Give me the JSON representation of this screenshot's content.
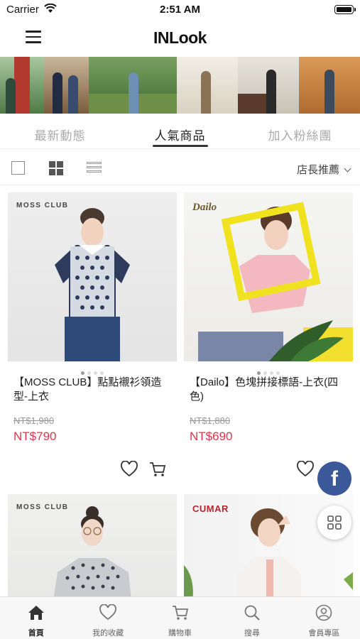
{
  "status_bar": {
    "carrier": "Carrier",
    "time": "2:51 AM"
  },
  "header": {
    "logo": "INLook"
  },
  "tabs": [
    {
      "label": "最新動態",
      "active": false
    },
    {
      "label": "人氣商品",
      "active": true
    },
    {
      "label": "加入粉絲團",
      "active": false
    }
  ],
  "view_bar": {
    "sort_label": "店長推薦"
  },
  "products": [
    {
      "brand": "MOSS CLUB",
      "name": "【MOSS CLUB】點點襯衫領造型-上衣",
      "old_price": "NT$1,980",
      "price": "NT$790"
    },
    {
      "brand": "Dailo",
      "name": "【Dailo】色塊拼接標語-上衣(四色)",
      "old_price": "NT$1,880",
      "price": "NT$690"
    },
    {
      "brand": "MOSS CLUB"
    },
    {
      "brand": "CUMAR"
    }
  ],
  "floating": {
    "facebook": "f"
  },
  "bottom_nav": [
    {
      "label": "首頁",
      "icon": "home-icon",
      "active": true
    },
    {
      "label": "我的收藏",
      "icon": "heart-icon",
      "active": false
    },
    {
      "label": "購物車",
      "icon": "cart-icon",
      "active": false
    },
    {
      "label": "搜尋",
      "icon": "search-icon",
      "active": false
    },
    {
      "label": "會員專區",
      "icon": "user-icon",
      "active": false
    }
  ],
  "colors": {
    "price_red": "#e6334c",
    "facebook_blue": "#3b5998"
  }
}
